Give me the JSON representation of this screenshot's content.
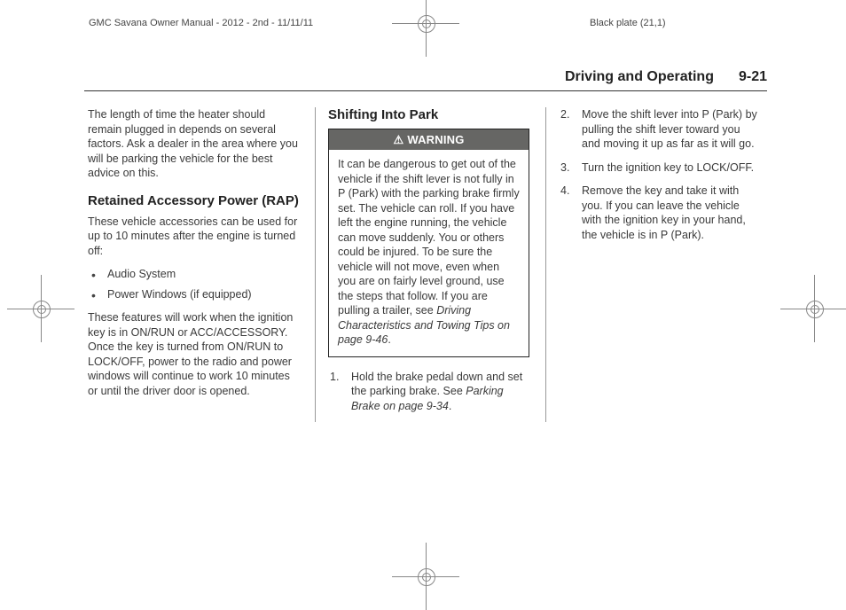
{
  "meta": {
    "left": "GMC Savana Owner Manual - 2012 - 2nd - 11/11/11",
    "right": "Black plate (21,1)"
  },
  "running_head": {
    "chapter": "Driving and Operating",
    "page": "9-21"
  },
  "col1": {
    "intro_para": "The length of time the heater should remain plugged in depends on several factors. Ask a dealer in the area where you will be parking the vehicle for the best advice on this.",
    "rap_title": "Retained Accessory Power (RAP)",
    "rap_para1": "These vehicle accessories can be used for up to 10 minutes after the engine is turned off:",
    "rap_bullets": {
      "0": "Audio System",
      "1": "Power Windows (if equipped)"
    },
    "rap_para2": "These features will work when the ignition key is in ON/RUN or ACC/ACCESSORY. Once the key is turned from ON/RUN to LOCK/OFF, power to the radio and power windows will continue to work 10 minutes or until the driver door is opened."
  },
  "col2": {
    "shift_title": "Shifting Into Park",
    "warning_label": "WARNING",
    "warning_body_main": "It can be dangerous to get out of the vehicle if the shift lever is not fully in P (Park) with the parking brake firmly set. The vehicle can roll. If you have left the engine running, the vehicle can move suddenly. You or others could be injured. To be sure the vehicle will not move, even when you are on fairly level ground, use the steps that follow. If you are pulling a trailer, see ",
    "warning_xref": "Driving Characteristics and Towing Tips on page 9-46",
    "warning_body_tail": ".",
    "step1_main": "Hold the brake pedal down and set the parking brake. See ",
    "step1_xref": "Parking Brake on page 9-34",
    "step1_tail": "."
  },
  "col3": {
    "step2": "Move the shift lever into P (Park) by pulling the shift lever toward you and moving it up as far as it will go.",
    "step3": "Turn the ignition key to LOCK/OFF.",
    "step4": "Remove the key and take it with you. If you can leave the vehicle with the ignition key in your hand, the vehicle is in P (Park)."
  }
}
